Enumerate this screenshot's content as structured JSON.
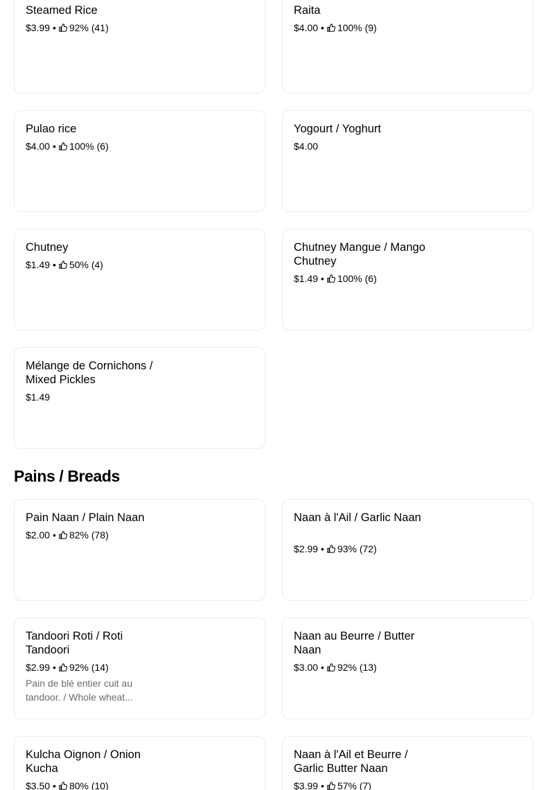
{
  "colors": {
    "card_border": "#ececec",
    "text": "#000000",
    "desc_text": "#6b6b6b"
  },
  "section_breads": {
    "title": "Pains / Breads"
  },
  "items": [
    {
      "name": "Steamed Rice",
      "price": "$3.99",
      "rating": "92% (41)"
    },
    {
      "name": "Raita",
      "price": "$4.00",
      "rating": "100% (9)"
    },
    {
      "name": "Pulao rice",
      "price": "$4.00",
      "rating": "100% (6)"
    },
    {
      "name": "Yogourt / Yoghurt",
      "price": "$4.00"
    },
    {
      "name": "Chutney",
      "price": "$1.49",
      "rating": "50% (4)"
    },
    {
      "name": "Chutney Mangue / Mango Chutney",
      "price": "$1.49",
      "rating": "100% (6)"
    },
    {
      "name": "Mélange de Cornichons / Mixed Pickles",
      "price": "$1.49"
    },
    {
      "name": "Pain Naan / Plain Naan",
      "price": "$2.00",
      "rating": "82% (78)"
    },
    {
      "name": "Naan à l'Ail / Garlic Naan",
      "price": "$2.99",
      "rating": "93% (72)"
    },
    {
      "name": "Tandoori Roti / Roti Tandoori",
      "price": "$2.99",
      "rating": "92% (14)",
      "description": "Pain de blé entier cuit au tandoor. / Whole wheat..."
    },
    {
      "name": "Naan au Beurre / Butter Naan",
      "price": "$3.00",
      "rating": "92% (13)"
    },
    {
      "name": "Kulcha Oignon / Onion Kucha",
      "price": "$3.50",
      "rating": "80% (10)"
    },
    {
      "name": "Naan à l'Ail et Beurre / Garlic Butter Naan",
      "price": "$3.99",
      "rating": "57% (7)"
    }
  ],
  "icons": {
    "rating": "thumbs-up-icon"
  }
}
